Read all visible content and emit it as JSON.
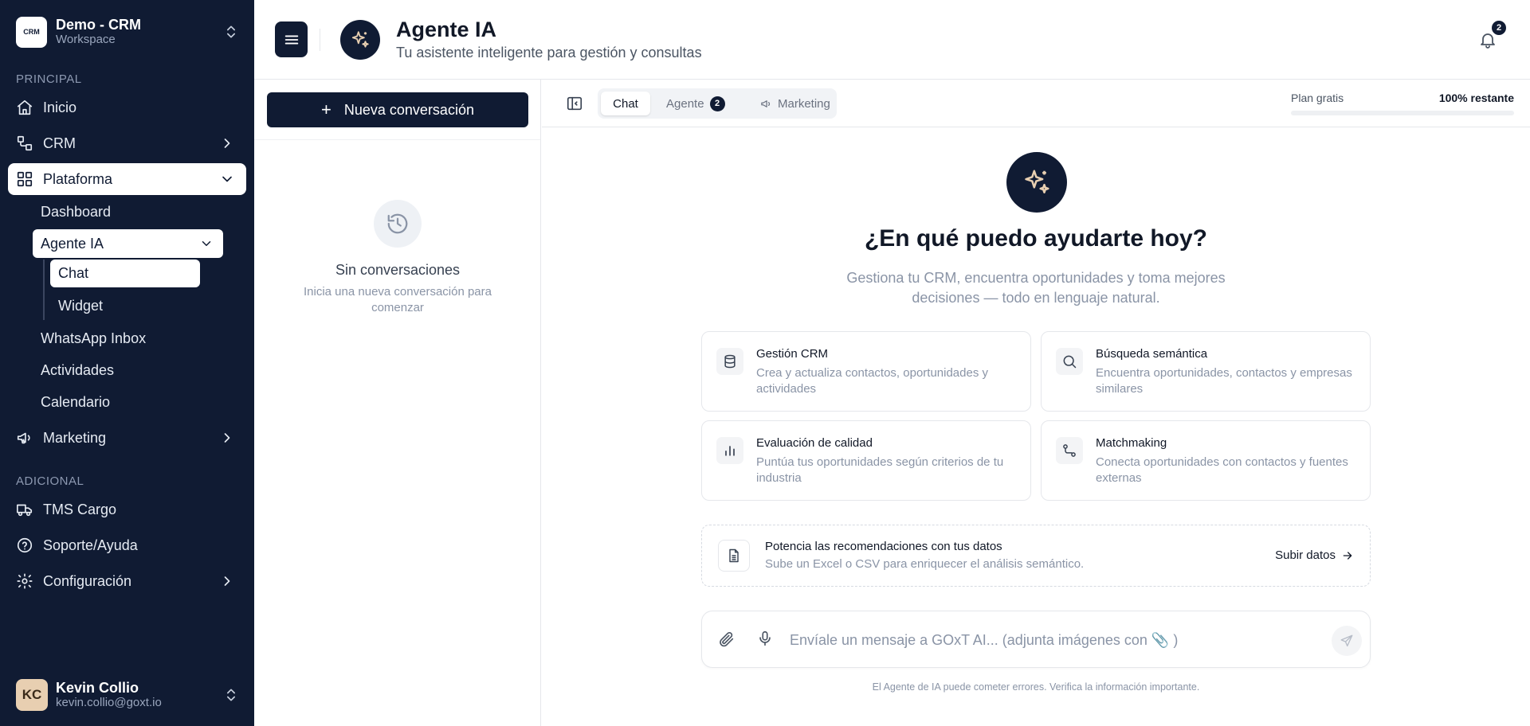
{
  "workspace": {
    "name": "Demo - CRM",
    "subtitle": "Workspace",
    "logo_text": "CRM"
  },
  "sidebar": {
    "section_principal": "PRINCIPAL",
    "inicio": "Inicio",
    "crm": "CRM",
    "plataforma": "Plataforma",
    "dashboard": "Dashboard",
    "agente_ia": "Agente IA",
    "chat": "Chat",
    "widget": "Widget",
    "whatsapp_inbox": "WhatsApp Inbox",
    "actividades": "Actividades",
    "calendario": "Calendario",
    "marketing": "Marketing",
    "section_adicional": "ADICIONAL",
    "tms_cargo": "TMS Cargo",
    "soporte": "Soporte/Ayuda",
    "configuracion": "Configuración"
  },
  "user": {
    "initials": "KC",
    "name": "Kevin Collio",
    "email": "kevin.collio@goxt.io"
  },
  "header": {
    "title": "Agente IA",
    "subtitle": "Tu asistente inteligente para gestión y consultas",
    "notification_count": "2"
  },
  "conversations": {
    "new_button": "Nueva conversación",
    "plus": "+",
    "empty_title": "Sin conversaciones",
    "empty_subtitle": "Inicia una nueva conversación para comenzar"
  },
  "tabs": [
    {
      "label": "Chat",
      "active": true
    },
    {
      "label": "Agente",
      "badge": "2"
    },
    {
      "label": "Marketing"
    }
  ],
  "plan": {
    "label": "Plan gratis",
    "remaining": "100% restante",
    "used_fraction": 0
  },
  "hero": {
    "title": "¿En qué puedo ayudarte hoy?",
    "subtitle": "Gestiona tu CRM, encuentra oportunidades y toma mejores decisiones — todo en lenguaje natural."
  },
  "cards": [
    {
      "icon": "database-icon",
      "title": "Gestión CRM",
      "desc": "Crea y actualiza contactos, oportunidades y actividades"
    },
    {
      "icon": "search-icon",
      "title": "Búsqueda semántica",
      "desc": "Encuentra oportunidades, contactos y empresas similares"
    },
    {
      "icon": "bar-chart-icon",
      "title": "Evaluación de calidad",
      "desc": "Puntúa tus oportunidades según criterios de tu industria"
    },
    {
      "icon": "route-icon",
      "title": "Matchmaking",
      "desc": "Conecta oportunidades con contactos y fuentes externas"
    }
  ],
  "upload": {
    "title": "Potencia las recomendaciones con tus datos",
    "desc": "Sube un Excel o CSV para enriquecer el análisis semántico.",
    "link": "Subir datos"
  },
  "composer": {
    "placeholder": "Envíale un mensaje a GOxT AI... (adjunta imágenes con 📎 )"
  },
  "disclaimer": "El Agente de IA puede cometer errores. Verifica la información importante.",
  "colors": {
    "navy": "#101b33",
    "muted": "#8a94a6",
    "border": "#e5e7eb"
  }
}
